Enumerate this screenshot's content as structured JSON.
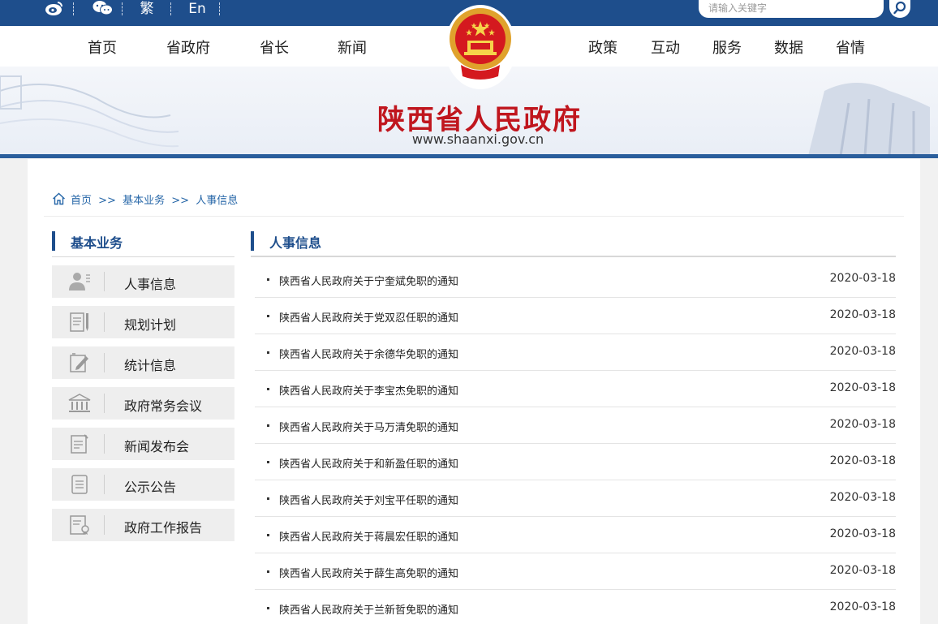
{
  "topbar": {
    "trad_label": "繁",
    "en_label": "En",
    "search_placeholder": "请输入关键字"
  },
  "nav": {
    "left": [
      "首页",
      "省政府",
      "省长",
      "新闻"
    ],
    "right": [
      "政策",
      "互动",
      "服务",
      "数据",
      "省情"
    ]
  },
  "banner": {
    "title": "陕西省人民政府",
    "url": "www.shaanxi.gov.cn"
  },
  "breadcrumb": [
    "首页",
    ">>",
    "基本业务",
    ">>",
    "人事信息"
  ],
  "sidebar": {
    "heading": "基本业务",
    "items": [
      {
        "label": "人事信息",
        "icon": "person-list-icon"
      },
      {
        "label": "规划计划",
        "icon": "document-pen-icon"
      },
      {
        "label": "统计信息",
        "icon": "edit-note-icon"
      },
      {
        "label": "政府常务会议",
        "icon": "government-building-icon"
      },
      {
        "label": "新闻发布会",
        "icon": "notepad-icon"
      },
      {
        "label": "公示公告",
        "icon": "notice-list-icon"
      },
      {
        "label": "政府工作报告",
        "icon": "report-certificate-icon"
      }
    ]
  },
  "main": {
    "heading": "人事信息",
    "items": [
      {
        "title": "陕西省人民政府关于宁奎斌免职的通知",
        "date": "2020-03-18"
      },
      {
        "title": "陕西省人民政府关于党双忍任职的通知",
        "date": "2020-03-18"
      },
      {
        "title": "陕西省人民政府关于余德华免职的通知",
        "date": "2020-03-18"
      },
      {
        "title": "陕西省人民政府关于李宝杰免职的通知",
        "date": "2020-03-18"
      },
      {
        "title": "陕西省人民政府关于马万清免职的通知",
        "date": "2020-03-18"
      },
      {
        "title": "陕西省人民政府关于和新盈任职的通知",
        "date": "2020-03-18"
      },
      {
        "title": "陕西省人民政府关于刘宝平任职的通知",
        "date": "2020-03-18"
      },
      {
        "title": "陕西省人民政府关于蒋晨宏任职的通知",
        "date": "2020-03-18"
      },
      {
        "title": "陕西省人民政府关于薛生高免职的通知",
        "date": "2020-03-18"
      },
      {
        "title": "陕西省人民政府关于兰新哲免职的通知",
        "date": "2020-03-18"
      }
    ]
  },
  "colors": {
    "primary": "#1e4e8c",
    "title_red": "#c0161e",
    "link_blue": "#2767a8"
  }
}
